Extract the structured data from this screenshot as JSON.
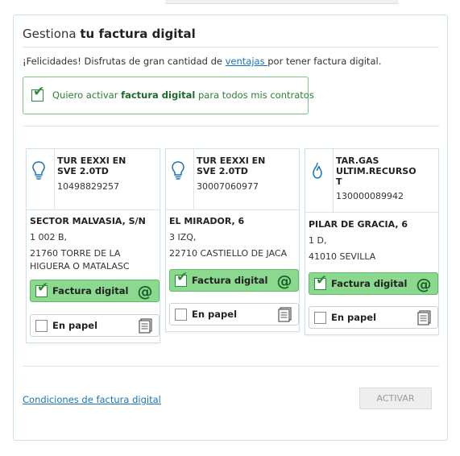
{
  "header": {
    "title_prefix": "Gestiona ",
    "title_bold": "tu factura digital"
  },
  "intro": {
    "before": "¡Felicidades! Disfrutas de gran cantidad de ",
    "link": "ventajas ",
    "after": "por tener factura digital."
  },
  "optin": {
    "before": "Quiero activar ",
    "bold": "factura digital",
    "after": " para todos mis contratos",
    "checked": true
  },
  "contracts": [
    {
      "type": "electricity",
      "icon": "lightbulb-icon",
      "tariff": "TUR EEXXI EN SVE 2.0TD",
      "contract_number": "10498829257",
      "street": "SECTOR MALVASIA, S/N",
      "line2": "1 002 B,",
      "line3": "21760 TORRE DE LA",
      "line4": "HIGUERA O MATALASC",
      "digital_label": "Factura digital",
      "paper_label": "En papel",
      "digital_checked": true,
      "paper_checked": false
    },
    {
      "type": "electricity",
      "icon": "lightbulb-icon",
      "tariff": "TUR EEXXI EN SVE 2.0TD",
      "contract_number": "30007060977",
      "street": "EL MIRADOR, 6",
      "line2": "3  IZQ,",
      "line3": "22710 CASTIELLO DE JACA",
      "line4": "",
      "digital_label": "Factura digital",
      "paper_label": "En papel",
      "digital_checked": true,
      "paper_checked": false
    },
    {
      "type": "gas",
      "icon": "flame-icon",
      "tariff": "TAR.GAS ULTIM.RECURSO T",
      "contract_number": "130000089942",
      "street": "PILAR DE GRACIA, 6",
      "line2": "1  D,",
      "line3": "41010 SEVILLA",
      "line4": "",
      "digital_label": "Factura digital",
      "paper_label": "En papel",
      "digital_checked": true,
      "paper_checked": false
    }
  ],
  "footer": {
    "conditions_link": "Condiciones de factura digital",
    "activate_button": "ACTIVAR"
  },
  "colors": {
    "accent_green": "#8bd88f",
    "link_blue": "#1a73b8",
    "border_blue": "#cfe3ef"
  }
}
